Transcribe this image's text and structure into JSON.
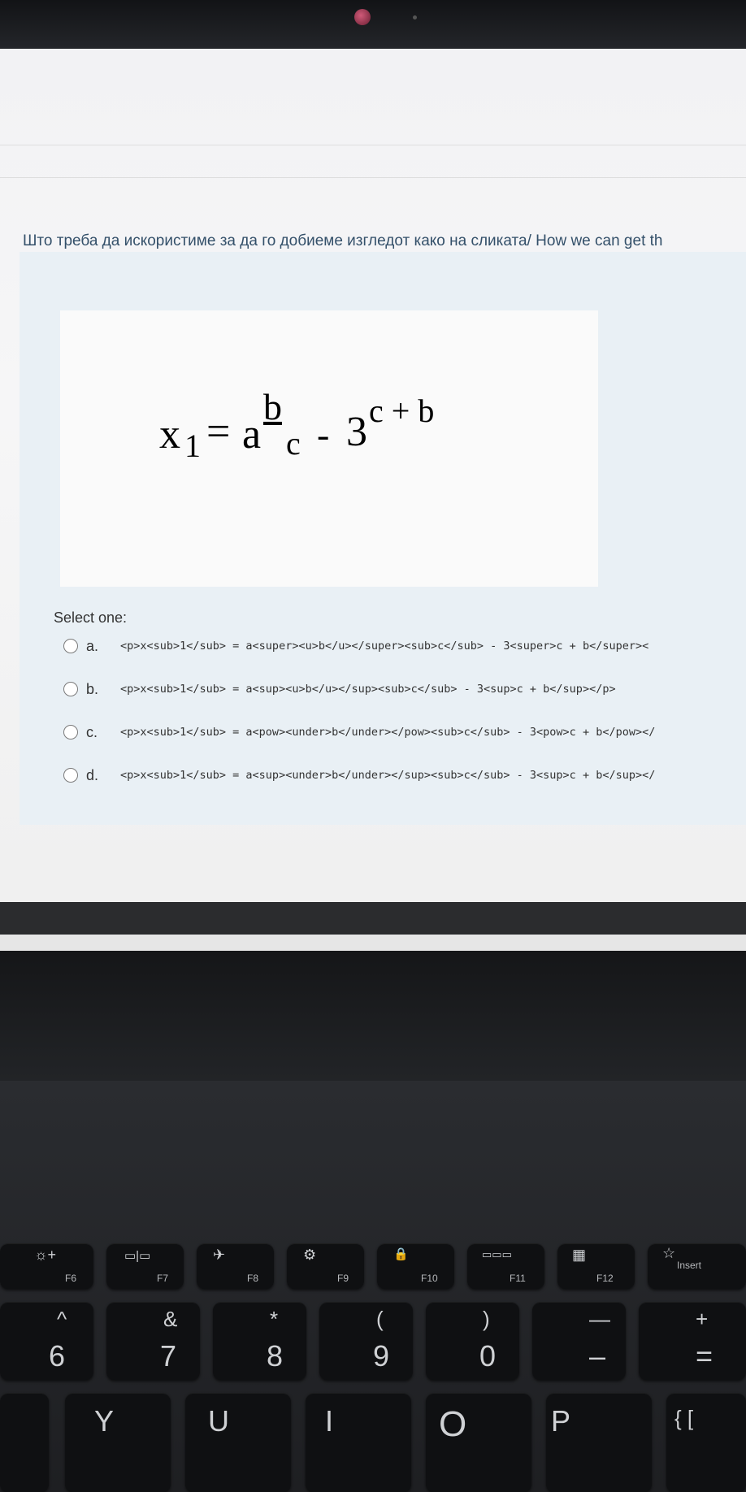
{
  "question": {
    "text": "Што треба да искористиме за да го добиеме изгледот како на сликата/ How we can get th"
  },
  "formula": {
    "x": "x",
    "x_sub": "1",
    "eq": "=",
    "a": "a",
    "b": "b",
    "c_sub": "c",
    "minus": "-",
    "three": "3",
    "sup": "c + b"
  },
  "select_label": "Select one:",
  "options": [
    {
      "letter": "a.",
      "code": "<p>x<sub>1</sub> = a<super><u>b</u></super><sub>c</sub> - 3<super>c + b</super><"
    },
    {
      "letter": "b.",
      "code": "<p>x<sub>1</sub> = a<sup><u>b</u></sup><sub>c</sub> - 3<sup>c + b</sup></p>"
    },
    {
      "letter": "c.",
      "code": "<p>x<sub>1</sub> = a<pow><under>b</under></pow><sub>c</sub> - 3<pow>c + b</pow></"
    },
    {
      "letter": "d.",
      "code": "<p>x<sub>1</sub> = a<sup><under>b</under></sup><sub>c</sub> - 3<sup>c + b</sup></"
    }
  ],
  "keyboard": {
    "fn_row": [
      {
        "label": "F6",
        "icon": "☼+",
        "icon_name": "brightness-up-icon"
      },
      {
        "label": "F7",
        "icon": "▭|▭",
        "icon_name": "display-switch-icon"
      },
      {
        "label": "F8",
        "icon": "✈",
        "icon_name": "airplane-mode-icon"
      },
      {
        "label": "F9",
        "icon": "⚙",
        "icon_name": "settings-icon"
      },
      {
        "label": "F10",
        "icon": "🔒",
        "icon_name": "lock-icon"
      },
      {
        "label": "F11",
        "icon": "▭▭▭",
        "icon_name": "keyboard-icon"
      },
      {
        "label": "F12",
        "icon": "▦",
        "icon_name": "calculator-icon"
      },
      {
        "label": "Insert",
        "icon": "☆",
        "icon_name": "star-icon"
      }
    ],
    "num_row": [
      {
        "top": "^",
        "bottom": "6"
      },
      {
        "top": "&",
        "bottom": "7"
      },
      {
        "top": "*",
        "bottom": "8"
      },
      {
        "top": "(",
        "bottom": "9"
      },
      {
        "top": ")",
        "bottom": "0"
      },
      {
        "top": "—",
        "bottom": "–"
      },
      {
        "top": "+",
        "bottom": "="
      }
    ],
    "letter_row": [
      "Y",
      "U",
      "I",
      "O",
      "P",
      "{ ["
    ]
  }
}
